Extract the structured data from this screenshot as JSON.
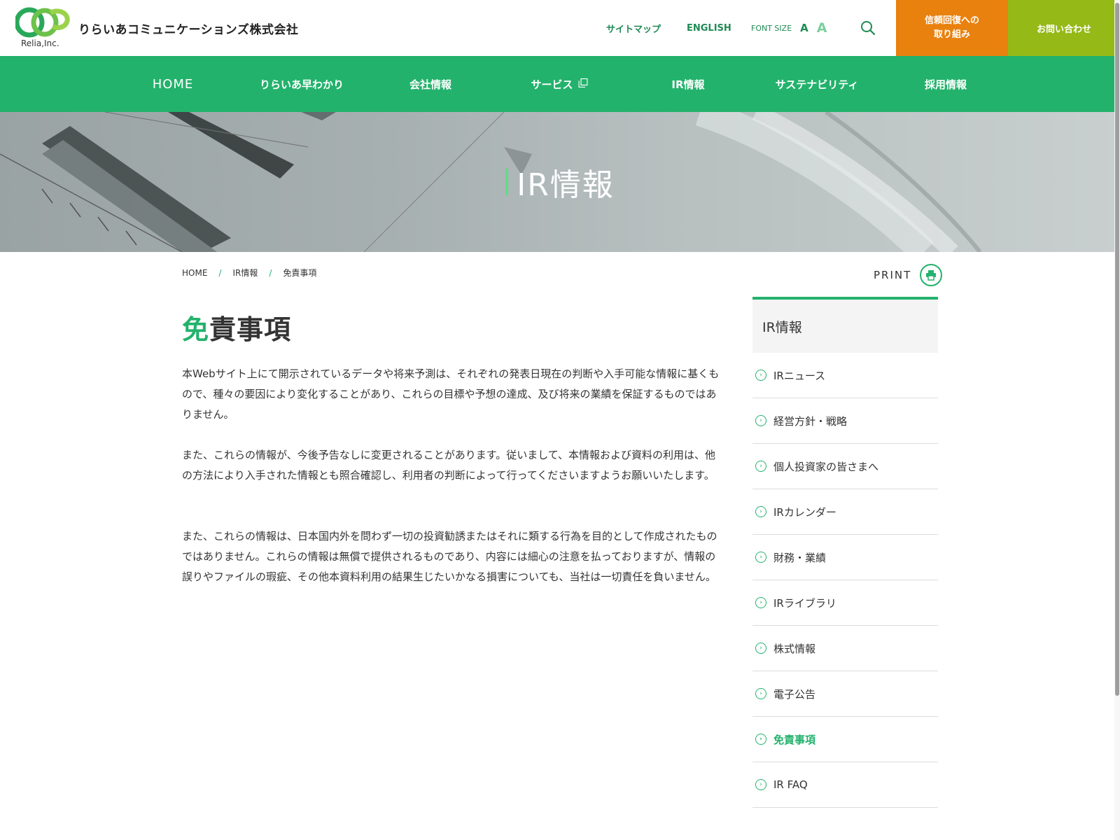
{
  "header": {
    "logo_name": "りらいあコミュニケーションズ株式会社",
    "logo_sub": "Relia,Inc.",
    "sitemap": "サイトマップ",
    "english": "ENGLISH",
    "font_size_label": "FONT SIZE",
    "font_size_small": "A",
    "font_size_large": "A",
    "cta_trust": "信頼回復への\n取り組み",
    "cta_contact": "お問い合わせ",
    "colors": {
      "brand_green": "#23b26c",
      "orange": "#e9810e",
      "lime": "#95b917"
    }
  },
  "nav": {
    "items": [
      {
        "label": "HOME"
      },
      {
        "label": "りらいあ早わかり"
      },
      {
        "label": "会社情報"
      },
      {
        "label": "サービス"
      },
      {
        "label": "IR情報"
      },
      {
        "label": "サステナビリティ"
      },
      {
        "label": "採用情報"
      }
    ]
  },
  "hero": {
    "title": "IR情報"
  },
  "breadcrumb": {
    "items": [
      {
        "label": "HOME"
      },
      {
        "label": "IR情報"
      },
      {
        "label": "免責事項"
      }
    ],
    "separator": "/"
  },
  "print": {
    "label": "PRINT"
  },
  "main": {
    "title_accent": "免",
    "title_rest": "責事項",
    "paragraphs": [
      "本Webサイト上にて開示されているデータや将来予測は、それぞれの発表日現在の判断や入手可能な情報に基くもので、種々の要因により変化することがあり、これらの目標や予想の達成、及び将来の業績を保証するものではありません。",
      "また、これらの情報が、今後予告なしに変更されることがあります。従いまして、本情報および資料の利用は、他の方法により入手された情報とも照合確認し、利用者の判断によって行ってくださいますようお願いいたします。",
      "また、これらの情報は、日本国内外を問わず一切の投資勧誘またはそれに類する行為を目的として作成されたものではありません。これらの情報は無償で提供されるものであり、内容には細心の注意を払っておりますが、情報の誤りやファイルの瑕疵、その他本資料利用の結果生じたいかなる損害についても、当社は一切責任を負いません。"
    ]
  },
  "sidebar": {
    "heading": "IR情報",
    "items": [
      {
        "label": "IRニュース"
      },
      {
        "label": "経営方針・戦略"
      },
      {
        "label": "個人投資家の皆さまへ"
      },
      {
        "label": "IRカレンダー"
      },
      {
        "label": "財務・業績"
      },
      {
        "label": "IRライブラリ"
      },
      {
        "label": "株式情報"
      },
      {
        "label": "電子公告"
      },
      {
        "label": "免責事項"
      },
      {
        "label": "IR FAQ"
      }
    ],
    "active_label": "免責事項"
  }
}
